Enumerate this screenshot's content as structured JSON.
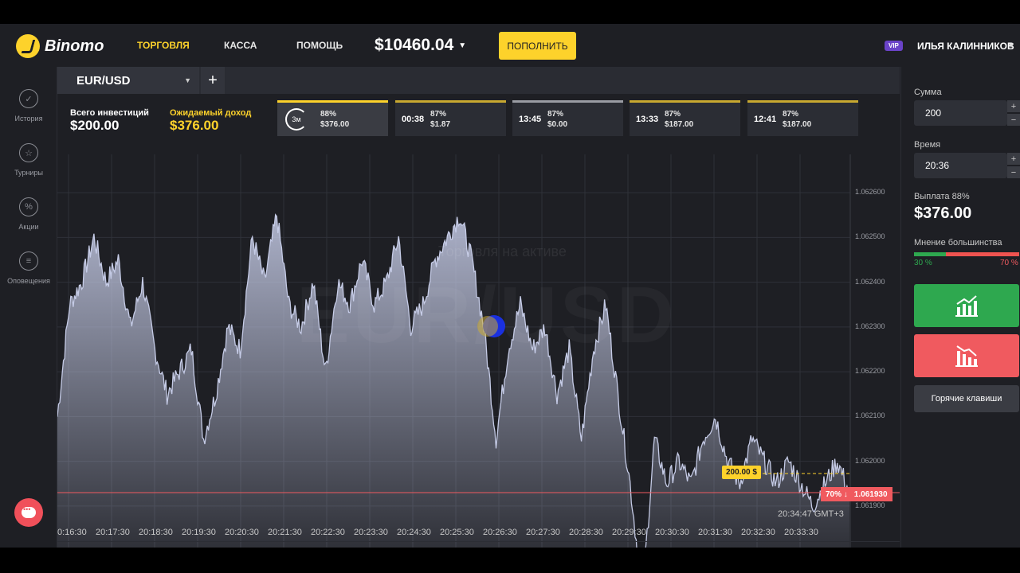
{
  "app": {
    "name": "Binomo"
  },
  "nav": {
    "trading": "ТОРГОВЛЯ",
    "cashier": "КАССА",
    "help": "ПОМОЩЬ"
  },
  "account": {
    "balance": "$10460.04",
    "deposit_label": "ПОПОЛНИТЬ",
    "vip_badge": "VIP",
    "username": "ИЛЬЯ КАЛИННИКОВ"
  },
  "sidebar": {
    "items": [
      {
        "label": "История",
        "icon": "check-icon"
      },
      {
        "label": "Турниры",
        "icon": "trophy-icon"
      },
      {
        "label": "Акции",
        "icon": "percent-icon"
      },
      {
        "label": "Оповещения",
        "icon": "bell-list-icon"
      }
    ]
  },
  "asset": {
    "name": "EUR/USD",
    "add_label": "+"
  },
  "summary": {
    "total_invest_label": "Всего инвестиций",
    "total_invest_value": "$200.00",
    "expected_label": "Ожидаемый доход",
    "expected_value": "$376.00"
  },
  "deals": [
    {
      "time": "3м",
      "percent": "88%",
      "amount": "$376.00"
    },
    {
      "time": "00:38",
      "percent": "87%",
      "amount": "$1.87"
    },
    {
      "time": "13:45",
      "percent": "87%",
      "amount": "$0.00"
    },
    {
      "time": "13:33",
      "percent": "87%",
      "amount": "$187.00"
    },
    {
      "time": "12:41",
      "percent": "87%",
      "amount": "$187.00"
    }
  ],
  "chart": {
    "watermark": "EUR/USD",
    "watermark_sub": "Торговля на активе",
    "price_labels": [
      "1.062600",
      "1.062500",
      "1.062400",
      "1.062300",
      "1.062200",
      "1.062100",
      "1.062000",
      "1.061900"
    ],
    "time_labels": [
      "0:16:30",
      "20:17:30",
      "20:18:30",
      "20:19:30",
      "20:20:30",
      "20:21:30",
      "20:22:30",
      "20:23:30",
      "20:24:30",
      "20:25:30",
      "20:26:30",
      "20:27:30",
      "20:28:30",
      "20:29:30",
      "20:30:30",
      "20:31:30",
      "20:32:30",
      "20:33:30"
    ],
    "current_price": "1.061930",
    "sentiment_marker": "70% ↓",
    "deal_marker": "200.00 $",
    "server_time": "20:34:47 GMT+3",
    "colors": {
      "line": "#c5cbe6",
      "current_line": "#f05a5f",
      "deal": "#fdd22b"
    }
  },
  "chart_data": {
    "type": "area",
    "title": "",
    "xlabel": "",
    "ylabel": "",
    "ylim": [
      1.06185,
      1.06265
    ],
    "points": [
      1.0621,
      1.06235,
      1.0624,
      1.0625,
      1.0624,
      1.06245,
      1.0623,
      1.0624,
      1.06225,
      1.06215,
      1.0622,
      1.06225,
      1.06205,
      1.06215,
      1.0623,
      1.06225,
      1.0625,
      1.0624,
      1.06255,
      1.06235,
      1.0623,
      1.0624,
      1.0622,
      1.0624,
      1.06235,
      1.06245,
      1.06235,
      1.0624,
      1.0625,
      1.0623,
      1.06235,
      1.06245,
      1.0625,
      1.06255,
      1.06245,
      1.0623,
      1.06205,
      1.06225,
      1.06235,
      1.06225,
      1.0623,
      1.06215,
      1.06225,
      1.06205,
      1.06225,
      1.06235,
      1.06215,
      1.06195,
      1.0617,
      1.06205,
      1.06195,
      1.062,
      1.06195,
      1.06205,
      1.0621,
      1.062,
      1.06195,
      1.06205,
      1.062,
      1.06195,
      1.062,
      1.06195,
      1.0619,
      1.06195,
      1.062,
      1.06193
    ]
  },
  "right_panel": {
    "amount_label": "Сумма",
    "amount_value": "200",
    "time_label": "Время",
    "time_value": "20:36",
    "payout_label": "Выплата 88%",
    "payout_value": "$376.00",
    "sentiment_label": "Мнение большинства",
    "sentiment_up": "30 %",
    "sentiment_down": "70 %",
    "sentiment_up_fraction": 0.3,
    "hotkeys_label": "Горячие клавиши",
    "plus": "+",
    "minus": "−"
  }
}
